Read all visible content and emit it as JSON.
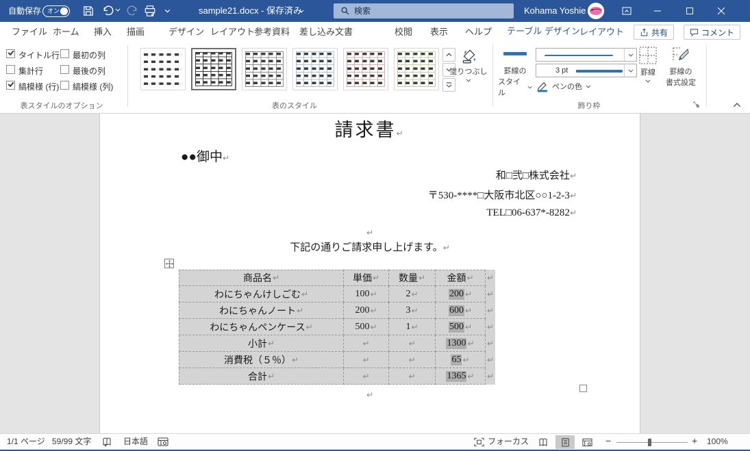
{
  "titlebar": {
    "autosave_label": "自動保存",
    "autosave_state": "オン",
    "doc_title": "sample21.docx - 保存済み",
    "search_placeholder": "検索",
    "user_name": "Kohama Yoshie"
  },
  "tabs": {
    "items": [
      "ファイル",
      "ホーム",
      "挿入",
      "描画",
      "デザイン",
      "レイアウト",
      "参考資料",
      "差し込み文書",
      "校閲",
      "表示",
      "ヘルプ"
    ],
    "contextual": [
      "テーブル デザイン",
      "レイアウト"
    ],
    "share": "共有",
    "comments": "コメント"
  },
  "ribbon": {
    "style_options": {
      "label": "表スタイルのオプション",
      "items": [
        {
          "label": "タイトル行",
          "checked": true
        },
        {
          "label": "集計行",
          "checked": false
        },
        {
          "label": "縞模様 (行)",
          "checked": true
        },
        {
          "label": "最初の列",
          "checked": false
        },
        {
          "label": "最後の列",
          "checked": false
        },
        {
          "label": "縞模様 (列)",
          "checked": false
        }
      ]
    },
    "table_styles": {
      "label": "表のスタイル",
      "shading": "塗りつぶし"
    },
    "borders_group": {
      "label": "飾り枠",
      "border_styles_line1": "罫線の",
      "border_styles_line2": "スタイル",
      "pen_weight": "3 pt",
      "pen_color": "ペンの色",
      "borders": "罫線",
      "border_painter_line1": "罫線の",
      "border_painter_line2": "書式設定"
    }
  },
  "doc": {
    "title": "請求書",
    "recipient": "●●御中",
    "company": "和□弐□株式会社",
    "address": "〒530-****□大阪市北区○○1-2-3",
    "tel": "TEL□06-637*-8282",
    "message": "下記の通りご請求申し上げます。",
    "table": {
      "headers": [
        "商品名",
        "単価",
        "数量",
        "金額"
      ],
      "rows": [
        {
          "name": "わにちゃんけしごむ",
          "price": "100",
          "qty": "2",
          "amount": "200"
        },
        {
          "name": "わにちゃんノート",
          "price": "200",
          "qty": "3",
          "amount": "600"
        },
        {
          "name": "わにちゃんペンケース",
          "price": "500",
          "qty": "1",
          "amount": "500"
        },
        {
          "name": "小計",
          "price": "",
          "qty": "",
          "amount": "1300"
        },
        {
          "name": "消費税（５％）",
          "price": "",
          "qty": "",
          "amount": "65"
        },
        {
          "name": "合計",
          "price": "",
          "qty": "",
          "amount": "1365"
        }
      ]
    }
  },
  "marks": {
    "paragraph": "↵",
    "cell_end": "↵"
  },
  "statusbar": {
    "page_info": "1/1 ページ",
    "char_count": "59/99 文字",
    "language": "日本語",
    "focus": "フォーカス",
    "zoom_level": "100%"
  },
  "colors": {
    "titlebar": "#2b579a",
    "accent": "#2e74b5",
    "selection": "#d4d4d4",
    "field_shading": "#aeaeae"
  }
}
